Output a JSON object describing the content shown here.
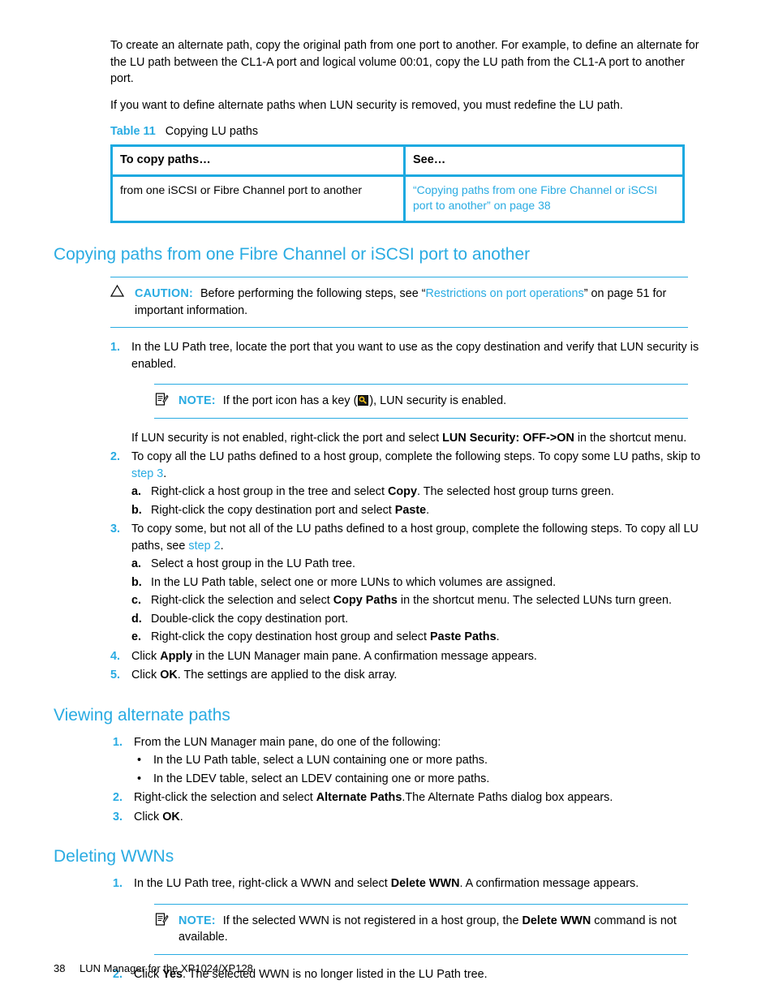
{
  "document": {
    "intro_paragraphs": [
      "To create an alternate path, copy the original path from one port to another. For example, to define an alternate for the LU path between the CL1-A port and logical volume 00:01, copy the LU path from the CL1-A port to another port.",
      "If you want to define alternate paths when LUN security is removed, you must redefine the LU path."
    ],
    "table": {
      "caption_number": "Table 11",
      "caption_text": "Copying LU paths",
      "headers": [
        "To copy paths…",
        "See…"
      ],
      "rows": [
        {
          "col1": "from one iSCSI or Fibre Channel port to another",
          "col2": "“Copying paths from one Fibre Channel or iSCSI port to another” on page 38"
        }
      ]
    },
    "section_copying": {
      "heading": "Copying paths from one Fibre Channel or iSCSI port to another",
      "caution": {
        "label": "CAUTION:",
        "text_before_link": "Before performing the following steps, see “",
        "link": "Restrictions on port operations",
        "text_after_link": "” on page 51 for important information."
      },
      "step1": {
        "num": "1.",
        "text": "In the LU Path tree, locate the port that you want to use as the copy destination and verify that LUN security is enabled."
      },
      "note1": {
        "label": "NOTE:",
        "text_before_icon": "If the port icon has a key (",
        "text_after_icon": "), LUN security is enabled."
      },
      "after_note_paragraph": {
        "text_1": "If LUN security is not enabled, right-click the port and select ",
        "bold_1": "LUN Security: OFF->ON",
        "text_2": " in the shortcut menu."
      },
      "step2": {
        "num": "2.",
        "text_1": "To copy all the LU paths defined to a host group, complete the following steps. To copy some LU paths, skip to ",
        "link": "step 3",
        "text_2": ".",
        "substeps": [
          {
            "letter": "a.",
            "text_1": "Right-click a host group in the tree and select ",
            "bold": "Copy",
            "text_2": ". The selected host group turns green."
          },
          {
            "letter": "b.",
            "text_1": "Right-click the copy destination port and select ",
            "bold": "Paste",
            "text_2": "."
          }
        ]
      },
      "step3": {
        "num": "3.",
        "text_1": "To copy some, but not all of the LU paths defined to a host group, complete the following steps. To copy all LU paths, see ",
        "link": "step 2",
        "text_2": ".",
        "substeps": [
          {
            "letter": "a.",
            "text_1": "Select a host group in the LU Path tree.",
            "bold": "",
            "text_2": ""
          },
          {
            "letter": "b.",
            "text_1": "In the LU Path table, select one or more LUNs to which volumes are assigned.",
            "bold": "",
            "text_2": ""
          },
          {
            "letter": "c.",
            "text_1": "Right-click the selection and select ",
            "bold": "Copy Paths",
            "text_2": " in the shortcut menu. The selected LUNs turn green."
          },
          {
            "letter": "d.",
            "text_1": "Double-click the copy destination port.",
            "bold": "",
            "text_2": ""
          },
          {
            "letter": "e.",
            "text_1": "Right-click the copy destination host group and select ",
            "bold": "Paste Paths",
            "text_2": "."
          }
        ]
      },
      "step4": {
        "num": "4.",
        "text_1": "Click ",
        "bold": "Apply",
        "text_2": " in the LUN Manager main pane. A confirmation message appears."
      },
      "step5": {
        "num": "5.",
        "text_1": "Click ",
        "bold": "OK",
        "text_2": ". The settings are applied to the disk array."
      }
    },
    "section_viewing": {
      "heading": "Viewing alternate paths",
      "step1": {
        "num": "1.",
        "text": "From the LUN Manager main pane, do one of the following:",
        "bullets": [
          "In the LU Path table, select a LUN containing one or more paths.",
          "In the LDEV table, select an LDEV containing one or more paths."
        ]
      },
      "step2": {
        "num": "2.",
        "text_1": "Right-click the selection and select ",
        "bold": "Alternate Paths",
        "text_2": ".The Alternate Paths dialog box appears."
      },
      "step3": {
        "num": "3.",
        "text_1": "Click ",
        "bold": "OK",
        "text_2": "."
      }
    },
    "section_deleting": {
      "heading": "Deleting WWNs",
      "step1": {
        "num": "1.",
        "text_1": "In the LU Path tree, right-click a WWN and select ",
        "bold": "Delete WWN",
        "text_2": ". A confirmation message appears."
      },
      "note2": {
        "label": "NOTE:",
        "text_1": "If the selected WWN is not registered in a host group, the ",
        "bold": "Delete WWN",
        "text_2": " command is not available."
      },
      "step2": {
        "num": "2.",
        "text_1": "Click ",
        "bold": "Yes",
        "text_2": ". The selected WWN is no longer listed in the LU Path tree."
      }
    },
    "footer": {
      "page_number": "38",
      "title": "LUN Manager for the XP1024/XP128"
    },
    "colors": {
      "accent": "#29abe2",
      "table_border": "#1ca9e0",
      "text": "#000000"
    }
  }
}
